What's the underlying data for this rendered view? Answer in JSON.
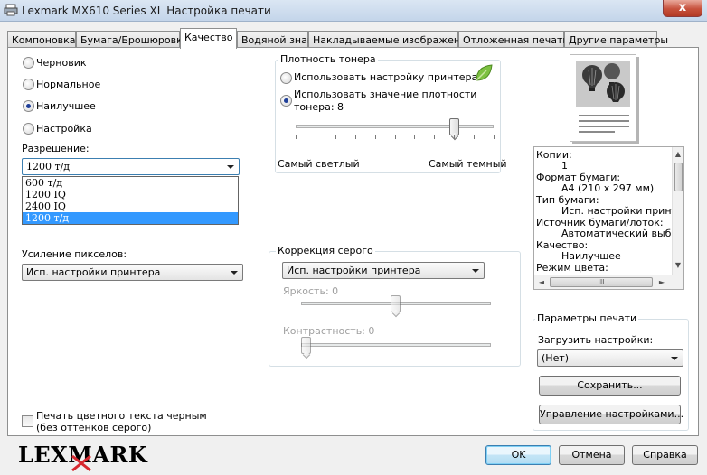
{
  "window": {
    "title": "Lexmark MX610 Series XL Настройка печати",
    "close_symbol": "x"
  },
  "tabs": [
    {
      "label": "Компоновка"
    },
    {
      "label": "Бумага/Брошюровка"
    },
    {
      "label": "Качество",
      "active": true
    },
    {
      "label": "Водяной знак"
    },
    {
      "label": "Накладываемые изображения"
    },
    {
      "label": "Отложенная печать"
    },
    {
      "label": "Другие параметры"
    }
  ],
  "quality": {
    "options": [
      {
        "label": "Черновик",
        "selected": false
      },
      {
        "label": "Нормальное",
        "selected": false
      },
      {
        "label": "Наилучшее",
        "selected": true
      },
      {
        "label": "Настройка",
        "selected": false
      }
    ],
    "resolution_label": "Разрешение:",
    "resolution_value": "1200 т/д",
    "resolution_options": [
      "600 т/д",
      "1200 IQ",
      "2400 IQ",
      "1200 т/д"
    ],
    "resolution_highlighted": "1200 т/д",
    "pixel_boost_label": "Усиление пикселов:",
    "pixel_boost_value": "Исп. настройки принтера"
  },
  "toner": {
    "group_title": "Плотность тонера",
    "use_printer_label": "Использовать настройку принтера",
    "use_value_label_line1": "Использовать значение плотности",
    "use_value_label_line2": "тонера: 8",
    "selected_option": "use_value",
    "value": 8,
    "min_label": "Самый светлый",
    "max_label": "Самый темный"
  },
  "gray_correction": {
    "group_title": "Коррекция серого",
    "value": "Исп. настройки принтера",
    "brightness_label": "Яркость: 0",
    "contrast_label": "Контрастность: 0"
  },
  "color_text_black": {
    "label_line1": "Печать цветного текста черным",
    "label_line2": "(без оттенков серого)",
    "checked": false
  },
  "summary": {
    "lines": [
      "Копии:",
      "1",
      "Формат бумаги:",
      "А4 (210 x 297 мм)",
      "Тип бумаги:",
      "Исп. настройки принтера",
      "Источник бумаги/лоток:",
      "Автоматический выбор",
      "Качество:",
      "Наилучшее",
      "Режим цвета:"
    ],
    "scroll_up": "▲",
    "scroll_down": "▼",
    "scroll_left": "◄",
    "scroll_right": "►",
    "grip": "III"
  },
  "print_settings": {
    "group_title": "Параметры печати",
    "load_label": "Загрузить настройки:",
    "load_value": "(Нет)",
    "save_button": "Сохранить...",
    "manage_button": "Управление настройками..."
  },
  "footer": {
    "logo": "LEXMARK",
    "ok": "OK",
    "cancel": "Отмена",
    "help": "Справка"
  },
  "colors": {
    "accent": "#3399ff",
    "logo_red": "#d7282f"
  }
}
